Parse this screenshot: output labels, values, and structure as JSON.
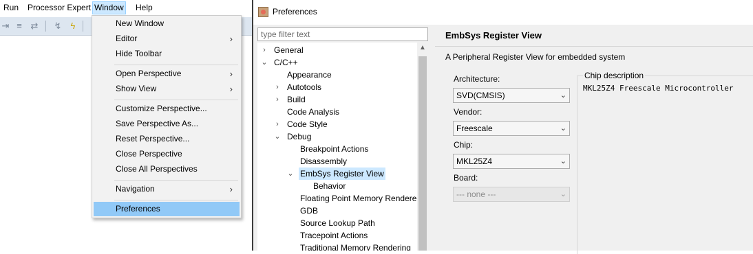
{
  "menubar": {
    "items": [
      {
        "label": "Run"
      },
      {
        "label": "Processor Expert"
      },
      {
        "label": "Window"
      },
      {
        "label": "Help"
      }
    ]
  },
  "window_menu": {
    "items": [
      {
        "label": "New Window",
        "submenu": false
      },
      {
        "label": "Editor",
        "submenu": true
      },
      {
        "label": "Hide Toolbar",
        "submenu": false
      },
      {
        "label": "Open Perspective",
        "submenu": true
      },
      {
        "label": "Show View",
        "submenu": true
      },
      {
        "label": "Customize Perspective...",
        "submenu": false
      },
      {
        "label": "Save Perspective As...",
        "submenu": false
      },
      {
        "label": "Reset Perspective...",
        "submenu": false
      },
      {
        "label": "Close Perspective",
        "submenu": false
      },
      {
        "label": "Close All Perspectives",
        "submenu": false
      },
      {
        "label": "Navigation",
        "submenu": true
      },
      {
        "label": "Preferences",
        "submenu": false,
        "selected": true
      }
    ],
    "arrow": "›"
  },
  "preferences": {
    "title": "Preferences",
    "filter_placeholder": "type filter text",
    "tree": [
      {
        "label": "General",
        "twisty": "›"
      },
      {
        "label": "C/C++",
        "twisty": "⌄"
      },
      {
        "label": "Appearance",
        "twisty": ""
      },
      {
        "label": "Autotools",
        "twisty": "›"
      },
      {
        "label": "Build",
        "twisty": "›"
      },
      {
        "label": "Code Analysis",
        "twisty": ""
      },
      {
        "label": "Code Style",
        "twisty": "›"
      },
      {
        "label": "Debug",
        "twisty": "⌄"
      },
      {
        "label": "Breakpoint Actions",
        "twisty": ""
      },
      {
        "label": "Disassembly",
        "twisty": ""
      },
      {
        "label": "EmbSys Register View",
        "twisty": "⌄",
        "selected": true
      },
      {
        "label": "Behavior",
        "twisty": ""
      },
      {
        "label": "Floating Point Memory Renderer",
        "twisty": ""
      },
      {
        "label": "GDB",
        "twisty": ""
      },
      {
        "label": "Source Lookup Path",
        "twisty": ""
      },
      {
        "label": "Tracepoint Actions",
        "twisty": ""
      },
      {
        "label": "Traditional Memory Rendering",
        "twisty": ""
      }
    ],
    "page": {
      "title": "EmbSys Register View",
      "description": "A Peripheral Register View for embedded system",
      "architecture": {
        "label": "Architecture:",
        "value": "SVD(CMSIS)"
      },
      "vendor": {
        "label": "Vendor:",
        "value": "Freescale"
      },
      "chip": {
        "label": "Chip:",
        "value": "MKL25Z4"
      },
      "board": {
        "label": "Board:",
        "value": "--- none ---"
      },
      "chip_description": {
        "label": "Chip description",
        "text": "MKL25Z4 Freescale Microcontroller"
      }
    }
  },
  "icons": {
    "combo_arrow": "⌄",
    "scroll_up": "▲"
  }
}
